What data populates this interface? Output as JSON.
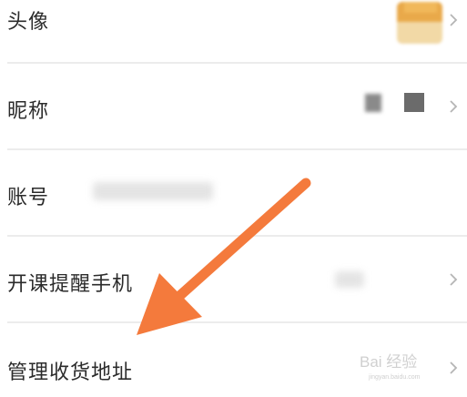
{
  "rows": [
    {
      "label": "头像"
    },
    {
      "label": "昵称"
    },
    {
      "label": "账号"
    },
    {
      "label": "开课提醒手机"
    },
    {
      "label": "管理收货地址"
    }
  ],
  "icons": {
    "chevron": "chevron-right-icon",
    "arrow": "orange-arrow"
  },
  "colors": {
    "arrow": "#f47a3c",
    "text": "#2b2b2b",
    "divider": "#ececec",
    "chevron": "#b5b5b5"
  },
  "watermark": {
    "text": "Bai 经验",
    "url": "jingyan.baidu.com"
  }
}
